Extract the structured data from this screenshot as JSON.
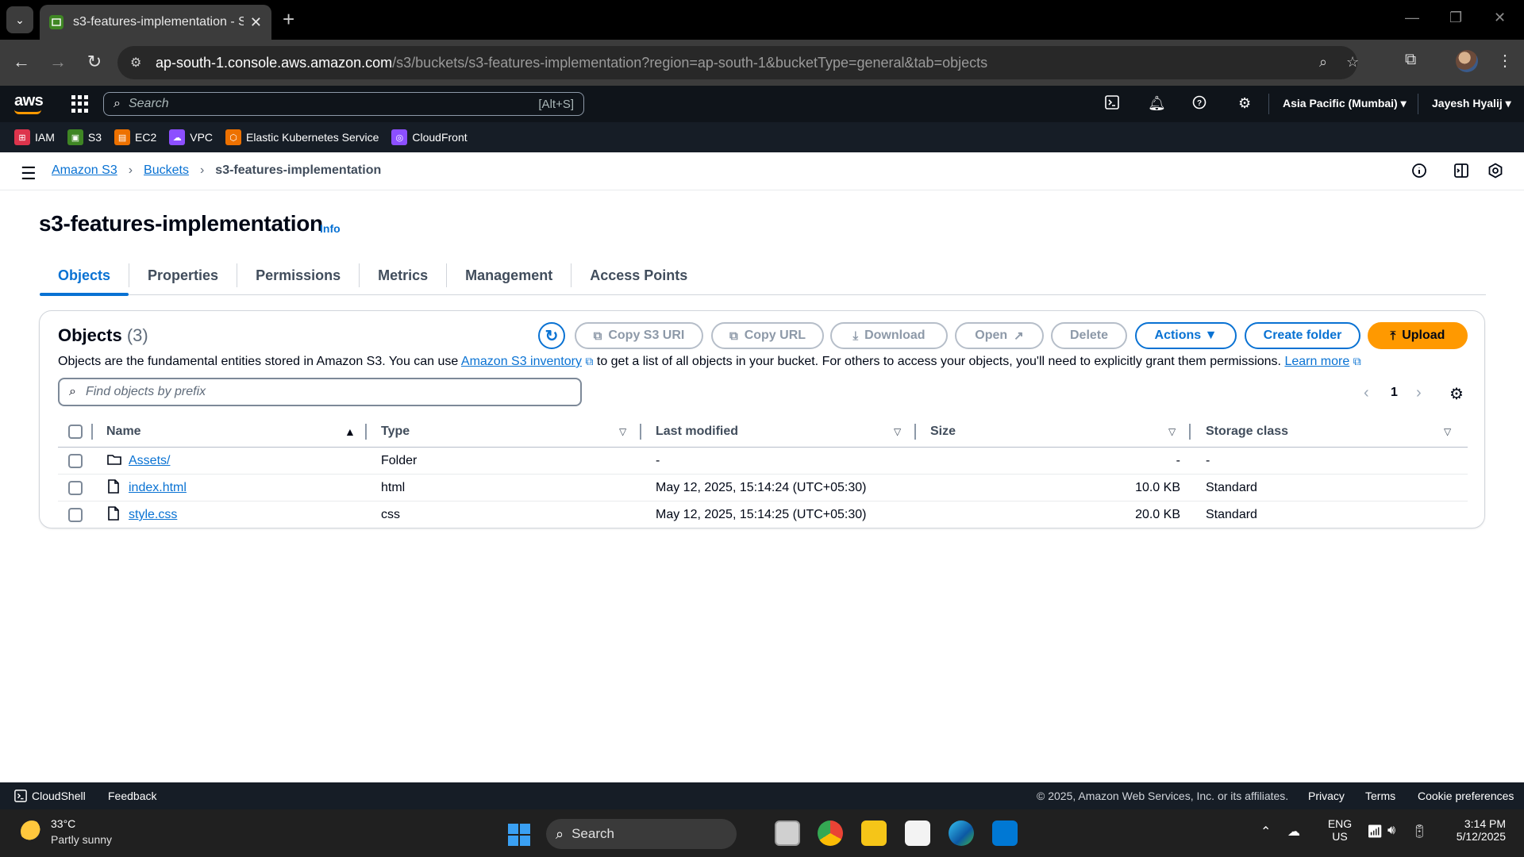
{
  "browser": {
    "tab_title": "s3-features-implementation - S",
    "url_host": "ap-south-1.console.aws.amazon.com",
    "url_path": "/s3/buckets/s3-features-implementation?region=ap-south-1&bucketType=general&tab=objects"
  },
  "aws_header": {
    "logo": "aws",
    "search_placeholder": "Search",
    "search_hint": "[Alt+S]",
    "region": "Asia Pacific (Mumbai) ▾",
    "user": "Jayesh Hyalij ▾"
  },
  "favorites": [
    {
      "label": "IAM",
      "color": "#dd344c"
    },
    {
      "label": "S3",
      "color": "#3f8624"
    },
    {
      "label": "EC2",
      "color": "#ed7100"
    },
    {
      "label": "VPC",
      "color": "#8c4fff"
    },
    {
      "label": "Elastic Kubernetes Service",
      "color": "#ed7100"
    },
    {
      "label": "CloudFront",
      "color": "#8c4fff"
    }
  ],
  "breadcrumb": {
    "items": [
      "Amazon S3",
      "Buckets"
    ],
    "current": "s3-features-implementation"
  },
  "page": {
    "title": "s3-features-implementation",
    "info": "Info"
  },
  "tabs": [
    "Objects",
    "Properties",
    "Permissions",
    "Metrics",
    "Management",
    "Access Points"
  ],
  "objects": {
    "heading": "Objects",
    "count": "(3)",
    "desc_1": "Objects are the fundamental entities stored in Amazon S3. You can use ",
    "desc_link_1": "Amazon S3 inventory",
    "desc_2": " to get a list of all objects in your bucket. For others to access your objects, you'll need to explicitly grant them permissions. ",
    "desc_link_2": "Learn more",
    "buttons": {
      "copy_s3_uri": "Copy S3 URI",
      "copy_url": "Copy URL",
      "download": "Download",
      "open": "Open",
      "delete": "Delete",
      "actions": "Actions ▼",
      "create_folder": "Create folder",
      "upload": "Upload"
    },
    "filter_placeholder": "Find objects by prefix",
    "page": "1",
    "columns": [
      "Name",
      "Type",
      "Last modified",
      "Size",
      "Storage class"
    ],
    "rows": [
      {
        "name": "Assets/",
        "type": "Folder",
        "modified": "-",
        "size": "-",
        "storage": "-",
        "icon": "folder-icon"
      },
      {
        "name": "index.html",
        "type": "html",
        "modified": "May 12, 2025, 15:14:24 (UTC+05:30)",
        "size": "10.0 KB",
        "storage": "Standard",
        "icon": "file-icon"
      },
      {
        "name": "style.css",
        "type": "css",
        "modified": "May 12, 2025, 15:14:25 (UTC+05:30)",
        "size": "20.0 KB",
        "storage": "Standard",
        "icon": "file-icon"
      }
    ]
  },
  "footer": {
    "cloudshell": "CloudShell",
    "feedback": "Feedback",
    "copyright": "© 2025, Amazon Web Services, Inc. or its affiliates.",
    "privacy": "Privacy",
    "terms": "Terms",
    "cookies": "Cookie preferences"
  },
  "taskbar": {
    "temp": "33°C",
    "weather": "Partly sunny",
    "search": "Search",
    "lang_1": "ENG",
    "lang_2": "US",
    "time": "3:14 PM",
    "date": "5/12/2025"
  },
  "colors": {
    "link": "#0972d3",
    "primary": "#ff9900",
    "header_bg": "#0f141a"
  }
}
